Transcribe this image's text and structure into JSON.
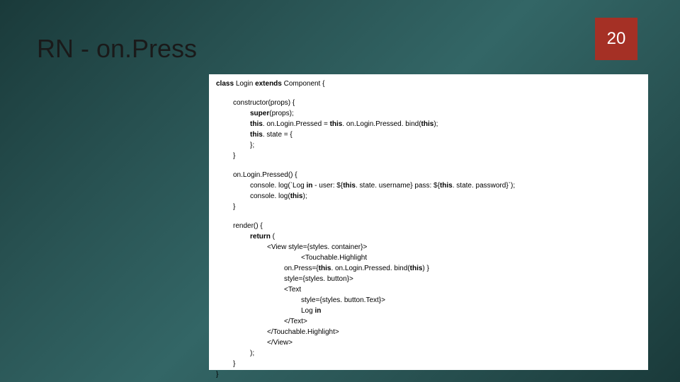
{
  "title": "RN - on.Press",
  "page_number": "20",
  "code": {
    "l1a": "class ",
    "l1b": "Login ",
    "l1c": "extends ",
    "l1d": "Component {",
    "l2": "constructor(props) {",
    "l3a": "super",
    "l3b": "(props);",
    "l4a": "this",
    "l4b": ". on.Login.Pressed = ",
    "l4c": "this",
    "l4d": ". on.Login.Pressed. bind(",
    "l4e": "this",
    "l4f": ");",
    "l5a": "this",
    "l5b": ". state = {",
    "l6": "};",
    "l7": "}",
    "l8": "on.Login.Pressed() {",
    "l9a": "console. log(`Log ",
    "l9b": "in ",
    "l9c": "- user: ${",
    "l9d": "this",
    "l9e": ". state. username} pass: ${",
    "l9f": "this",
    "l9g": ". state. password}`);",
    "l10a": "console. log(",
    "l10b": "this",
    "l10c": ");",
    "l11": "}",
    "l12": "render() {",
    "l13a": "return ",
    "l13b": "(",
    "l14": "<View style={styles. container}>",
    "l15": "<Touchable.Highlight",
    "l16a": "on.Press={",
    "l16b": "this",
    "l16c": ". on.Login.Pressed. bind(",
    "l16d": "this",
    "l16e": ") }",
    "l17": "style={styles. button}>",
    "l18": "<Text",
    "l19": "style={styles. button.Text}>",
    "l20a": "Log ",
    "l20b": "in",
    "l21": "</Text>",
    "l22": "</Touchable.Highlight>",
    "l23": "</View>",
    "l24": ");",
    "l25": "}",
    "l26": "}"
  }
}
